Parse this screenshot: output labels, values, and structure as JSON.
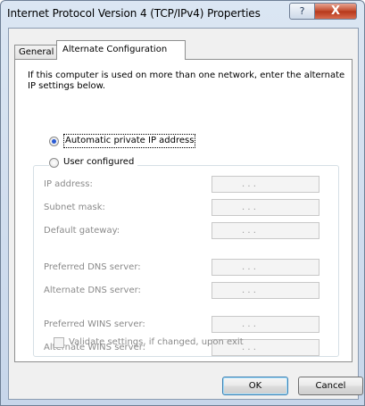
{
  "window": {
    "title": "Internet Protocol Version 4 (TCP/IPv4) Properties",
    "help_label": "?",
    "close_label": "X"
  },
  "tabs": [
    {
      "label": "General"
    },
    {
      "label": "Alternate Configuration"
    }
  ],
  "description": "If this computer is used on more than one network, enter the alternate IP settings below.",
  "options": {
    "automatic": {
      "label": "Automatic private IP address",
      "selected": true
    },
    "user_configured": {
      "label": "User configured",
      "selected": false
    }
  },
  "fields": [
    {
      "label": "IP address:",
      "dots": ".          .          ."
    },
    {
      "label": "Subnet mask:",
      "dots": ".          .          ."
    },
    {
      "label": "Default gateway:",
      "dots": ".          .          ."
    },
    {
      "label": "Preferred DNS server:",
      "dots": ".          .          ."
    },
    {
      "label": "Alternate DNS server:",
      "dots": ".          .          ."
    },
    {
      "label": "Preferred WINS server:",
      "dots": ".          .          ."
    },
    {
      "label": "Alternate WINS server:",
      "dots": ".          .          ."
    }
  ],
  "validate": {
    "label": "Validate settings, if changed, upon exit",
    "checked": false
  },
  "buttons": {
    "ok": "OK",
    "cancel": "Cancel"
  }
}
